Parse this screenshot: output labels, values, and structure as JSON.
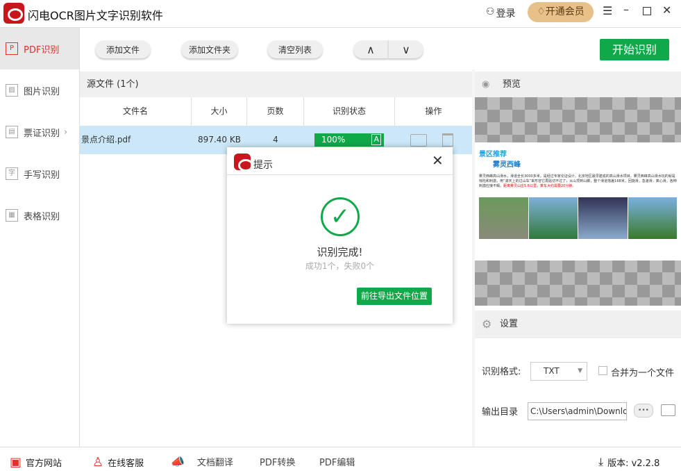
{
  "app": {
    "title": "闪电OCR图片文字识别软件",
    "login": "登录",
    "vip": "开通会员"
  },
  "sidebar": {
    "items": [
      {
        "label": "PDF识别",
        "icon": "P"
      },
      {
        "label": "图片识别",
        "icon": "▨"
      },
      {
        "label": "票证识别",
        "icon": "▤"
      },
      {
        "label": "手写识别",
        "icon": "字"
      },
      {
        "label": "表格识别",
        "icon": "▦"
      }
    ]
  },
  "toolbar": {
    "add_file": "添加文件",
    "add_folder": "添加文件夹",
    "clear": "清空列表",
    "up": "∧",
    "down": "∨",
    "start": "开始识别"
  },
  "files": {
    "title": "源文件 (1个)",
    "headers": [
      "文件名",
      "大小",
      "页数",
      "识别状态",
      "操作"
    ],
    "rows": [
      {
        "name": "景点介绍.pdf",
        "size": "897.40 KB",
        "pages": "4",
        "progress_label": "100%",
        "progress": 100
      }
    ]
  },
  "preview": {
    "title": "预览",
    "heading1": "景区推荐",
    "heading2": "雾灵西峰",
    "body": "雾灵西峰高山滑水，滑道全长3000多米，是经过专家论证设计，北京地区最早建成的高山滑水项目。雾灵西峰高山滑水玩的就是惊险和刺激，用“滚天上的过山车”来形容它再贴切不过了，从山顶到山脚，整个滑道落差168米，回旋滑，急速滑，离心滑，各种刺激应接不暇。",
    "highlight": "距离雾灵山庄5.6公里，乘车大约需要20分钟。"
  },
  "settings": {
    "title": "设置",
    "format_label": "识别格式:",
    "format_value": "TXT",
    "merge_label": "合并为一个文件",
    "output_label": "输出目录",
    "output_value": "C:\\Users\\admin\\Downlo",
    "browse": "•••"
  },
  "dialog": {
    "title": "提示",
    "heading": "识别完成!",
    "sub": "成功1个，失败0个",
    "button": "前往导出文件位置"
  },
  "footer": {
    "site": "官方网站",
    "service": "在线客服",
    "translate": "文档翻译",
    "convert": "PDF转换",
    "edit": "PDF编辑",
    "version": "版本: v2.2.8"
  },
  "colors": {
    "accent": "#0fa94a",
    "brand": "#c8161d",
    "selected_row": "#cce8f8"
  }
}
